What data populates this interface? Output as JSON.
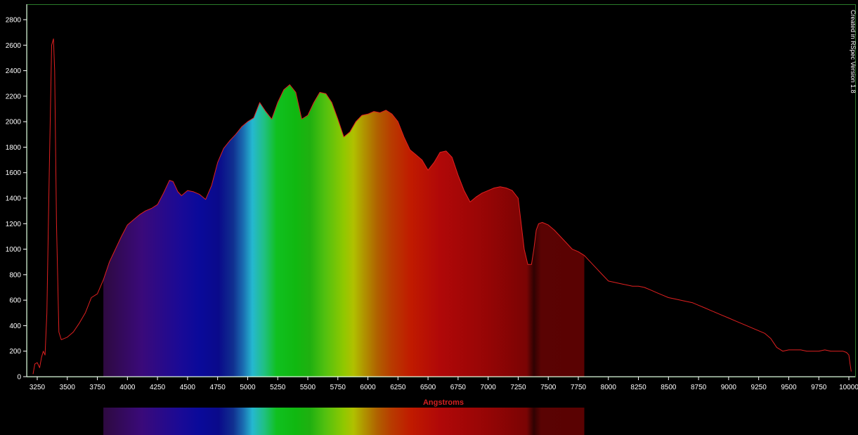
{
  "chart_data": {
    "type": "area",
    "title": "",
    "xlabel": "Angstroms",
    "ylabel": "",
    "credit": "Created in RSpec Version 1.8",
    "xlim": [
      3200,
      10050
    ],
    "ylim": [
      0,
      2900
    ],
    "x_ticks": [
      3250,
      3500,
      3750,
      4000,
      4250,
      4500,
      4750,
      5000,
      5250,
      5500,
      5750,
      6000,
      6250,
      6500,
      6750,
      7000,
      7250,
      7500,
      7750,
      8000,
      8250,
      8500,
      8750,
      9000,
      9250,
      9500,
      9750,
      10000
    ],
    "y_ticks": [
      0,
      200,
      400,
      600,
      800,
      1000,
      1200,
      1400,
      1600,
      1800,
      2000,
      2200,
      2400,
      2600,
      2800
    ],
    "grid": false,
    "spectrum_band_range": [
      3800,
      7800
    ],
    "series": [
      {
        "color": "#e02020",
        "x": [
          3215,
          3230,
          3250,
          3270,
          3285,
          3300,
          3315,
          3330,
          3350,
          3370,
          3385,
          3395,
          3410,
          3430,
          3450,
          3500,
          3550,
          3600,
          3650,
          3700,
          3750,
          3800,
          3850,
          3900,
          3950,
          4000,
          4050,
          4100,
          4150,
          4200,
          4250,
          4300,
          4350,
          4380,
          4420,
          4450,
          4500,
          4550,
          4600,
          4650,
          4700,
          4750,
          4800,
          4850,
          4900,
          4950,
          5000,
          5050,
          5100,
          5150,
          5200,
          5250,
          5300,
          5350,
          5400,
          5450,
          5500,
          5550,
          5600,
          5650,
          5700,
          5750,
          5800,
          5850,
          5900,
          5950,
          6000,
          6050,
          6100,
          6150,
          6200,
          6250,
          6300,
          6350,
          6400,
          6450,
          6500,
          6550,
          6600,
          6650,
          6700,
          6750,
          6800,
          6850,
          6900,
          6950,
          7000,
          7050,
          7100,
          7150,
          7200,
          7250,
          7300,
          7330,
          7360,
          7380,
          7400,
          7420,
          7450,
          7500,
          7550,
          7600,
          7650,
          7700,
          7750,
          7800,
          7850,
          7900,
          7950,
          8000,
          8050,
          8100,
          8150,
          8200,
          8250,
          8300,
          8350,
          8400,
          8450,
          8500,
          8550,
          8600,
          8650,
          8700,
          8750,
          8800,
          8850,
          8900,
          8950,
          9000,
          9050,
          9100,
          9150,
          9200,
          9250,
          9300,
          9350,
          9400,
          9450,
          9500,
          9550,
          9600,
          9650,
          9700,
          9750,
          9800,
          9850,
          9900,
          9950,
          9980,
          10000,
          10010,
          10020
        ],
        "y": [
          20,
          100,
          110,
          70,
          150,
          200,
          170,
          500,
          1600,
          2600,
          2650,
          2400,
          1200,
          350,
          290,
          310,
          350,
          420,
          500,
          620,
          650,
          760,
          900,
          1000,
          1100,
          1190,
          1230,
          1270,
          1300,
          1320,
          1350,
          1440,
          1540,
          1530,
          1450,
          1420,
          1460,
          1450,
          1430,
          1390,
          1500,
          1680,
          1790,
          1850,
          1900,
          1960,
          2000,
          2030,
          2150,
          2080,
          2020,
          2150,
          2250,
          2290,
          2230,
          2020,
          2050,
          2150,
          2230,
          2220,
          2150,
          2020,
          1880,
          1920,
          2000,
          2050,
          2060,
          2080,
          2070,
          2090,
          2060,
          2000,
          1880,
          1780,
          1740,
          1700,
          1620,
          1680,
          1760,
          1770,
          1720,
          1580,
          1460,
          1370,
          1410,
          1440,
          1460,
          1480,
          1490,
          1480,
          1460,
          1400,
          1000,
          880,
          880,
          1000,
          1150,
          1200,
          1210,
          1190,
          1150,
          1100,
          1050,
          1000,
          980,
          950,
          900,
          850,
          800,
          750,
          740,
          730,
          720,
          710,
          710,
          700,
          680,
          660,
          640,
          620,
          610,
          600,
          590,
          580,
          560,
          540,
          520,
          500,
          480,
          460,
          440,
          420,
          400,
          380,
          360,
          340,
          300,
          230,
          200,
          210,
          210,
          210,
          200,
          200,
          200,
          210,
          200,
          200,
          200,
          190,
          170,
          100,
          40
        ]
      }
    ]
  }
}
